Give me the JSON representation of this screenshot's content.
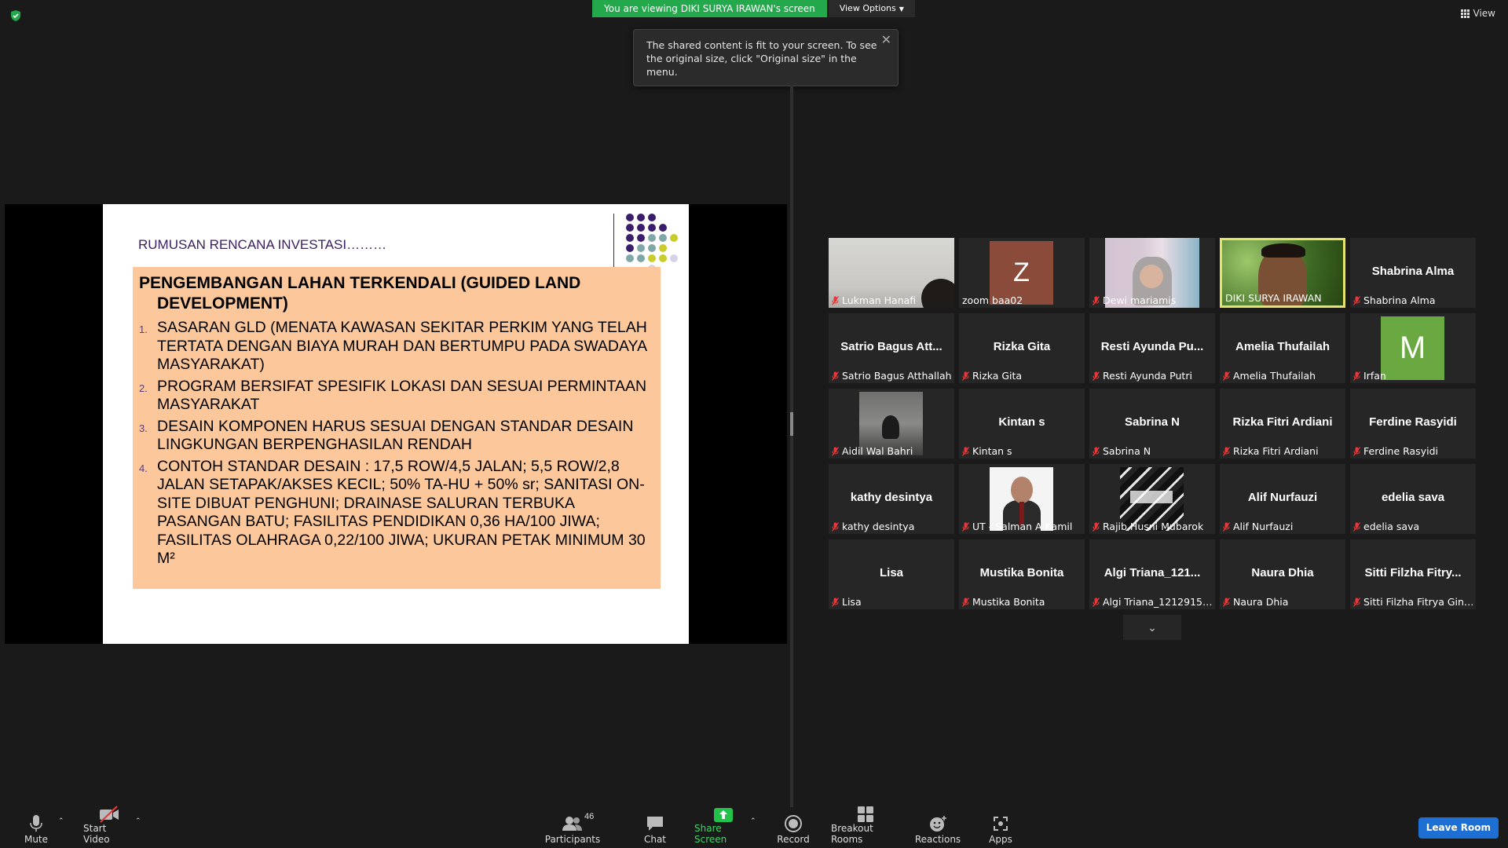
{
  "banner": {
    "viewing": "You are viewing DIKI SURYA IRAWAN's screen",
    "view_options": "View Options"
  },
  "top_right": {
    "view_label": "View"
  },
  "tooltip": {
    "text": "The shared content is fit to your screen. To see the original size, click \"Original size\" in the menu."
  },
  "slide": {
    "title": "RUMUSAN RENCANA INVESTASI………",
    "heading_line1": "PENGEMBANGAN LAHAN TERKENDALI (GUIDED LAND",
    "heading_line2": "DEVELOPMENT)",
    "items": [
      {
        "num": "1.",
        "text": "SASARAN GLD (MENATA KAWASAN SEKITAR PERKIM YANG TELAH TERTATA DENGAN BIAYA MURAH DAN BERTUMPU PADA SWADAYA MASYARAKAT)"
      },
      {
        "num": "2.",
        "text": "PROGRAM BERSIFAT SPESIFIK LOKASI DAN SESUAI PERMINTAAN MASYARAKAT"
      },
      {
        "num": "3.",
        "text": "DESAIN KOMPONEN HARUS SESUAI DENGAN STANDAR DESAIN LINGKUNGAN BERPENGHASILAN RENDAH"
      },
      {
        "num": "4.",
        "text": "CONTOH STANDAR DESAIN : 17,5 ROW/4,5 JALAN; 5,5 ROW/2,8 JALAN SETAPAK/AKSES KECIL; 50% TA-HU + 50% sr; SANITASI ON-SITE DIBUAT PENGHUNI; DRAINASE SALURAN TERBUKA PASANGAN BATU; FASILITAS PENDIDIKAN 0,36 HA/100 JIWA; FASILITAS OLAHRAGA 0,22/100 JIWA; UKURAN PETAK MINIMUM 30 M²"
      }
    ]
  },
  "participants": [
    {
      "center": "",
      "label": "Lukman Hanafi",
      "muted": true,
      "media": "video-dim"
    },
    {
      "center": "",
      "label": "zoom baa02",
      "muted": false,
      "media": "avatar-z",
      "avatar_letter": "Z"
    },
    {
      "center": "",
      "label": "Dewi mariamis",
      "muted": true,
      "media": "video-dewi"
    },
    {
      "center": "",
      "label": "DIKI SURYA IRAWAN",
      "muted": false,
      "media": "video-diki"
    },
    {
      "center": "Shabrina Alma",
      "label": "Shabrina Alma",
      "muted": true,
      "media": "none"
    },
    {
      "center": "Satrio Bagus Att...",
      "label": "Satrio Bagus Atthallah",
      "muted": true,
      "media": "none"
    },
    {
      "center": "Rizka Gita",
      "label": "Rizka Gita",
      "muted": true,
      "media": "none"
    },
    {
      "center": "Resti Ayunda Pu...",
      "label": "Resti Ayunda Putri",
      "muted": true,
      "media": "none"
    },
    {
      "center": "Amelia Thufailah",
      "label": "Amelia Thufailah",
      "muted": true,
      "media": "none"
    },
    {
      "center": "",
      "label": "Irfan",
      "muted": true,
      "media": "avatar-m",
      "avatar_letter": "M"
    },
    {
      "center": "",
      "label": "Aidil Wal Bahri",
      "muted": true,
      "media": "photo-aidil"
    },
    {
      "center": "Kintan s",
      "label": "Kintan s",
      "muted": true,
      "media": "none"
    },
    {
      "center": "Sabrina N",
      "label": "Sabrina N",
      "muted": true,
      "media": "none"
    },
    {
      "center": "Rizka Fitri Ardiani",
      "label": "Rizka Fitri Ardiani",
      "muted": true,
      "media": "none"
    },
    {
      "center": "Ferdine Rasyidi",
      "label": "Ferdine Rasyidi",
      "muted": true,
      "media": "none"
    },
    {
      "center": "kathy desintya",
      "label": "kathy desintya",
      "muted": true,
      "media": "none"
    },
    {
      "center": "",
      "label": "UT - Salman A Kamil",
      "muted": true,
      "media": "photo-salman"
    },
    {
      "center": "",
      "label": "Rajib Husni Mubarok",
      "muted": true,
      "media": "photo-rajib"
    },
    {
      "center": "Alif Nurfauzi",
      "label": "Alif Nurfauzi",
      "muted": true,
      "media": "none"
    },
    {
      "center": "edelia sava",
      "label": "edelia sava",
      "muted": true,
      "media": "none"
    },
    {
      "center": "Lisa",
      "label": "Lisa",
      "muted": true,
      "media": "none"
    },
    {
      "center": "Mustika Bonita",
      "label": "Mustika Bonita",
      "muted": true,
      "media": "none"
    },
    {
      "center": "Algi Triana_121...",
      "label": "Algi Triana_12129150...",
      "muted": true,
      "media": "none"
    },
    {
      "center": "Naura Dhia",
      "label": "Naura Dhia",
      "muted": true,
      "media": "none"
    },
    {
      "center": "Sitti Filzha Fitry...",
      "label": "Sitti Filzha Fitrya Gino...",
      "muted": true,
      "media": "none"
    }
  ],
  "toolbar": {
    "mute": "Mute",
    "start_video": "Start Video",
    "participants": "Participants",
    "participants_count": "46",
    "chat": "Chat",
    "share_screen": "Share Screen",
    "record": "Record",
    "breakout": "Breakout Rooms",
    "reactions": "Reactions",
    "apps": "Apps",
    "leave": "Leave Room"
  },
  "colors": {
    "share_green": "#23a84b",
    "leave_blue": "#1d6fd3",
    "active_border": "#e6e36a",
    "slide_box": "#fcc79a",
    "avatar_m": "#6aa842",
    "avatar_z": "#8a4b3a"
  }
}
